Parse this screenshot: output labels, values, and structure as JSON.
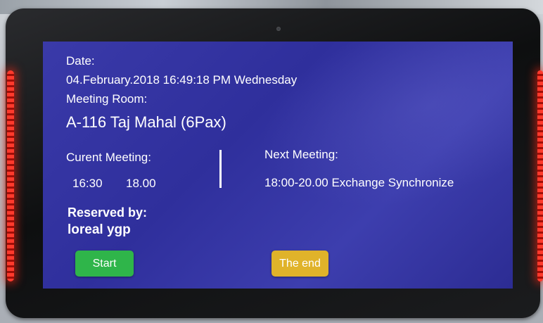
{
  "screen": {
    "date_label": "Date:",
    "date_value": "04.February.2018 16:49:18 PM Wednesday",
    "room_label": "Meeting Room:",
    "room_value": "A-116 Taj Mahal  (6Pax)",
    "current_label": "Curent Meeting:",
    "current_start": "16:30",
    "current_end": "18.00",
    "next_label": "Next Meeting:",
    "next_value": "18:00-20.00  Exchange Synchronize",
    "reserved_label": "Reserved by:",
    "reserved_value": "loreal ygp",
    "start_button": "Start",
    "end_button": "The end"
  },
  "colors": {
    "screen_bg": "#3333a3",
    "start_button": "#2fb54a",
    "end_button": "#e0b32a",
    "led": "#ff3a2c"
  }
}
